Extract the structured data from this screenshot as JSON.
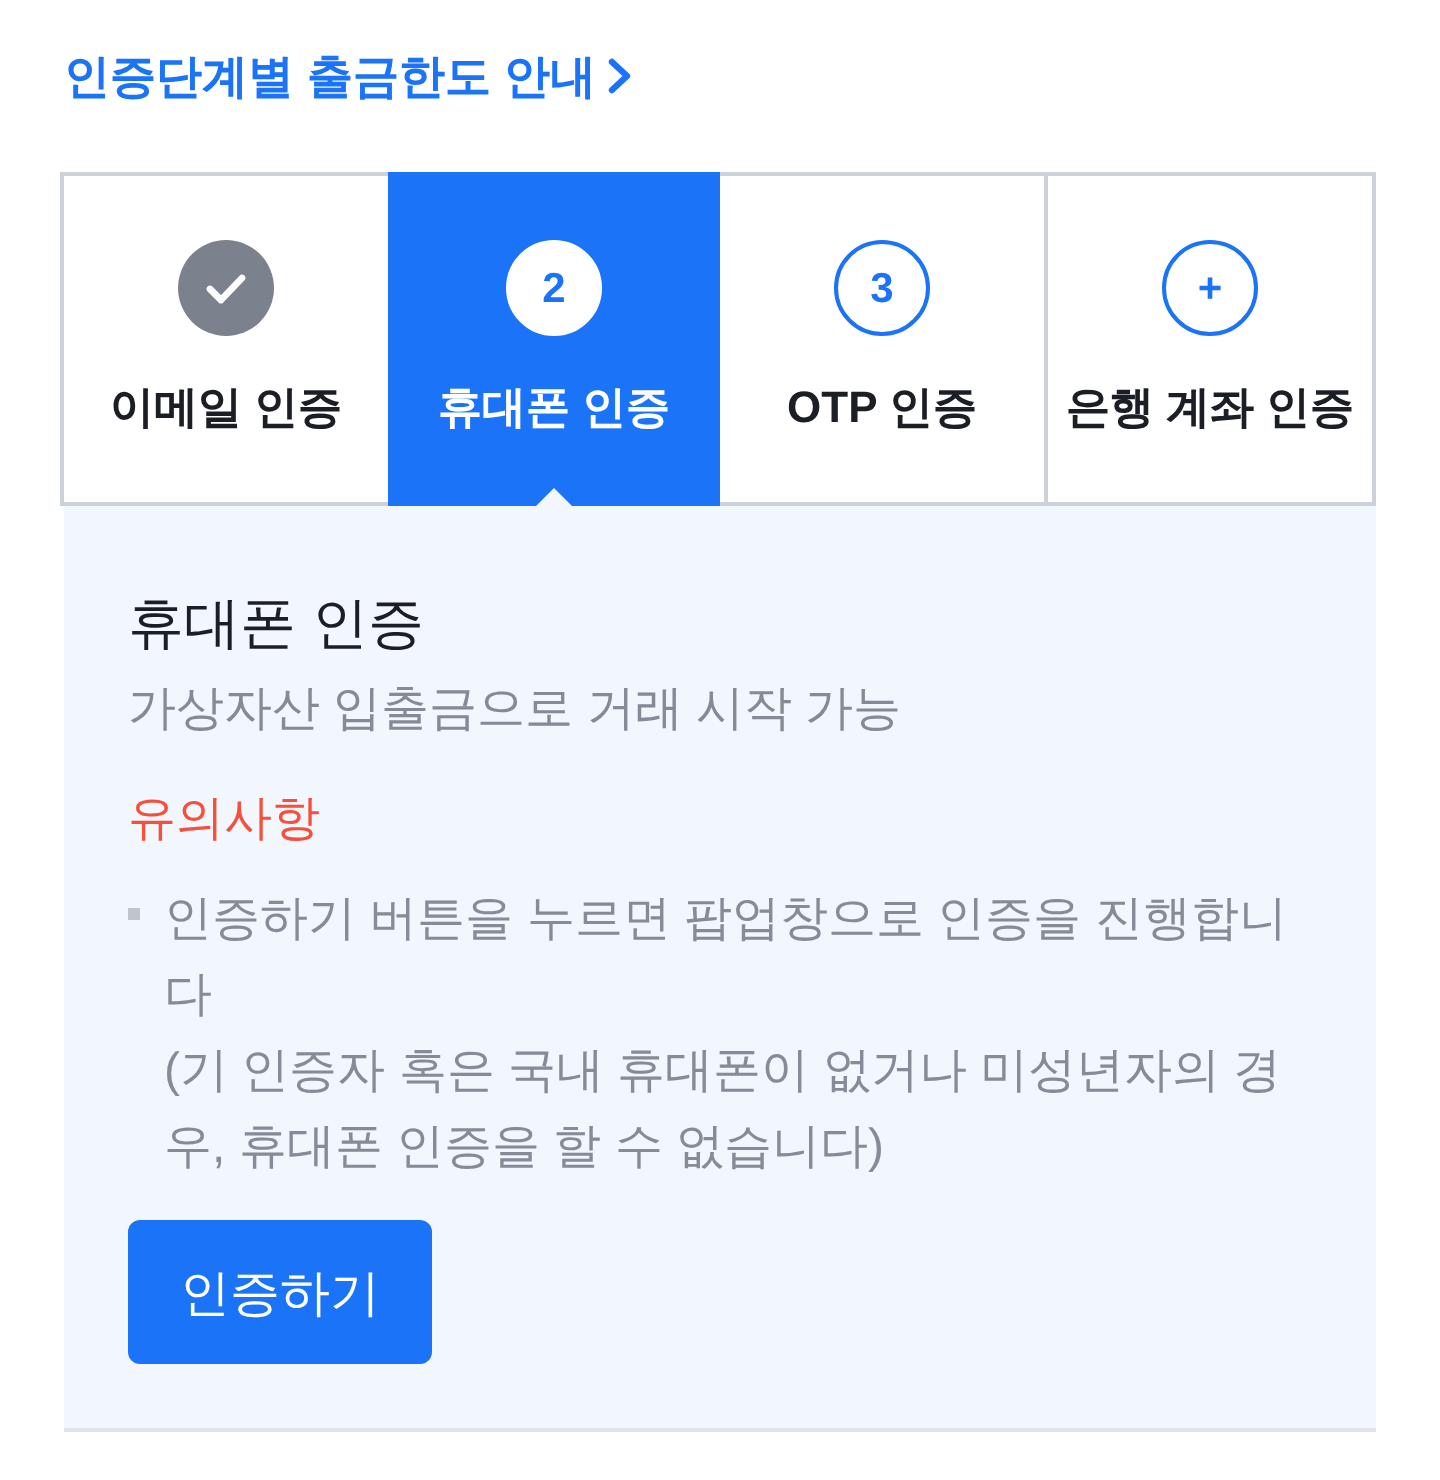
{
  "guide_link": {
    "label": "인증단계별 출금한도 안내"
  },
  "steps": [
    {
      "label": "이메일 인증",
      "completed": true,
      "selected": false
    },
    {
      "label": "휴대폰 인증",
      "marker": "2",
      "completed": false,
      "selected": true
    },
    {
      "label": "OTP 인증",
      "marker": "3",
      "completed": false,
      "selected": false
    },
    {
      "label": "은행 계좌 인증",
      "marker": "+",
      "completed": false,
      "selected": false
    }
  ],
  "panel": {
    "title": "휴대폰 인증",
    "subtitle": "가상자산 입출금으로 거래 시작 가능",
    "notice_heading": "유의사항",
    "notices": [
      {
        "text": "인증하기 버튼을 누르면 팝업창으로 인증을 진행합니다",
        "detail": "(기 인증자 혹은 국내 휴대폰이 없거나 미성년자의 경우, 휴대폰 인증을 할 수 없습니다)"
      }
    ],
    "button": "인증하기"
  }
}
